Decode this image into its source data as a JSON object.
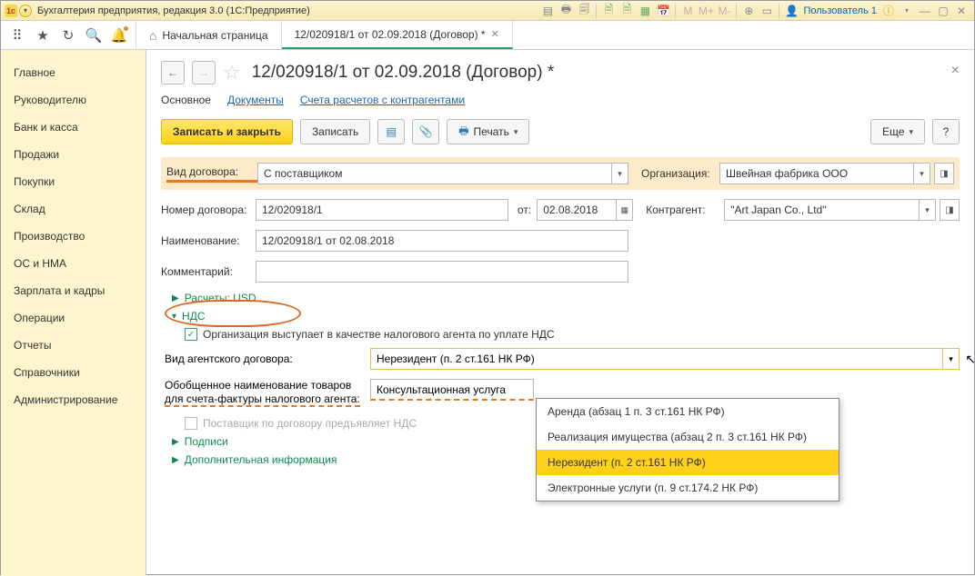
{
  "titlebar": {
    "title": "Бухгалтерия предприятия, редакция 3.0  (1С:Предприятие)",
    "user": "Пользователь 1"
  },
  "tabs": {
    "home": "Начальная страница",
    "active": "12/020918/1 от 02.09.2018 (Договор) *"
  },
  "sidebar": [
    "Главное",
    "Руководителю",
    "Банк и касса",
    "Продажи",
    "Покупки",
    "Склад",
    "Производство",
    "ОС и НМА",
    "Зарплата и кадры",
    "Операции",
    "Отчеты",
    "Справочники",
    "Администрирование"
  ],
  "page": {
    "title": "12/020918/1 от 02.09.2018 (Договор) *"
  },
  "subtabs": {
    "main": "Основное",
    "docs": "Документы",
    "accounts": "Счета расчетов с контрагентами"
  },
  "actions": {
    "save_close": "Записать и закрыть",
    "save": "Записать",
    "print": "Печать",
    "more": "Еще",
    "help": "?"
  },
  "form": {
    "contract_type_lbl": "Вид договора:",
    "contract_type_val": "С поставщиком",
    "org_lbl": "Организация:",
    "org_val": "Швейная фабрика ООО",
    "num_lbl": "Номер договора:",
    "num_val": "12/020918/1",
    "from_lbl": "от:",
    "from_val": "02.08.2018",
    "contr_lbl": "Контрагент:",
    "contr_val": "\"Art Japan Co., Ltd\"",
    "name_lbl": "Наименование:",
    "name_val": "12/020918/1 от 02.08.2018",
    "comment_lbl": "Комментарий:",
    "comment_val": ""
  },
  "expand": {
    "calc": "Расчеты: USD",
    "nds": "НДС",
    "sign": "Подписи",
    "extra": "Дополнительная информация"
  },
  "nds": {
    "agent_chk": "Организация выступает в качестве налогового агента по уплате НДС",
    "agent_type_lbl": "Вид агентского договора:",
    "agent_type_val": "Нерезидент (п. 2 ст.161 НК РФ)",
    "goods_lbl1": "Обобщенное наименование товаров",
    "goods_lbl2": "для счета-фактуры налогового агента:",
    "goods_val": "Консультационная услуга",
    "supplier_vat": "Поставщик по договору предъявляет НДС"
  },
  "dropdown": {
    "opts": [
      "Аренда (абзац 1 п. 3 ст.161 НК РФ)",
      "Реализация имущества (абзац 2 п. 3 ст.161 НК РФ)",
      "Нерезидент (п. 2 ст.161 НК РФ)",
      "Электронные услуги (п. 9 ст.174.2 НК РФ)"
    ]
  }
}
